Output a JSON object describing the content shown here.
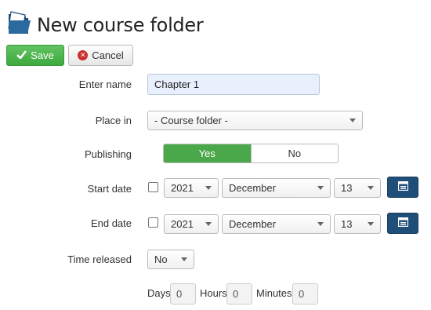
{
  "page": {
    "title": "New course folder"
  },
  "toolbar": {
    "save_label": "Save",
    "cancel_label": "Cancel"
  },
  "labels": {
    "name": "Enter name",
    "place_in": "Place in",
    "publishing": "Publishing",
    "start_date": "Start date",
    "end_date": "End date",
    "time_released": "Time released"
  },
  "form": {
    "name_value": "Chapter 1",
    "place_in_value": "- Course folder -",
    "publishing": {
      "yes": "Yes",
      "no": "No",
      "selected": "Yes"
    },
    "start_date": {
      "checked": false,
      "year": "2021",
      "month": "December",
      "day": "13"
    },
    "end_date": {
      "checked": false,
      "year": "2021",
      "month": "December",
      "day": "13"
    },
    "time_released_value": "No",
    "days_label": "Days",
    "days_value": "0",
    "hours_label": "Hours",
    "hours_value": "0",
    "minutes_label": "Minutes",
    "minutes_value": "0"
  },
  "colors": {
    "save_green": "#4cae4c",
    "toggle_green": "#4aa84a",
    "calendar_button": "#1f4e79",
    "cancel_red": "#c9302c",
    "name_field_bg": "#e8f0fe"
  },
  "icons": {
    "header": "folder-icon",
    "save": "check-icon",
    "cancel": "x-circle-icon",
    "calendar": "calendar-icon"
  }
}
